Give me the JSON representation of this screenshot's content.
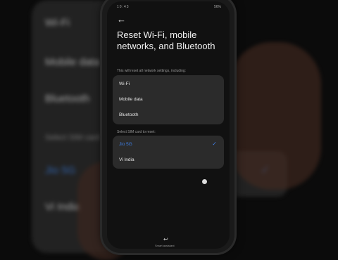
{
  "screen": {
    "status_time": "10:43",
    "status_right": "56%",
    "title": "Reset Wi-Fi, mobile networks, and Bluetooth",
    "subtitle": "This will reset all network settings, including:",
    "network_items": [
      "Wi-Fi",
      "Mobile data",
      "Bluetooth"
    ],
    "sim_label": "Select SIM card to reset:",
    "sim_items": [
      {
        "label": "Jio 5G",
        "selected": true
      },
      {
        "label": "Vi India",
        "selected": false
      }
    ],
    "nav_label": "Smart assistant"
  },
  "background": {
    "items": [
      "Wi-Fi",
      "Mobile data",
      "Bluetooth"
    ],
    "sim_label": "Select SIM card",
    "sim_items": [
      "Jio 5G",
      "Vi India"
    ]
  },
  "colors": {
    "accent": "#3e7fe6",
    "panel": "#2b2b2b",
    "screen_bg": "#111111"
  }
}
